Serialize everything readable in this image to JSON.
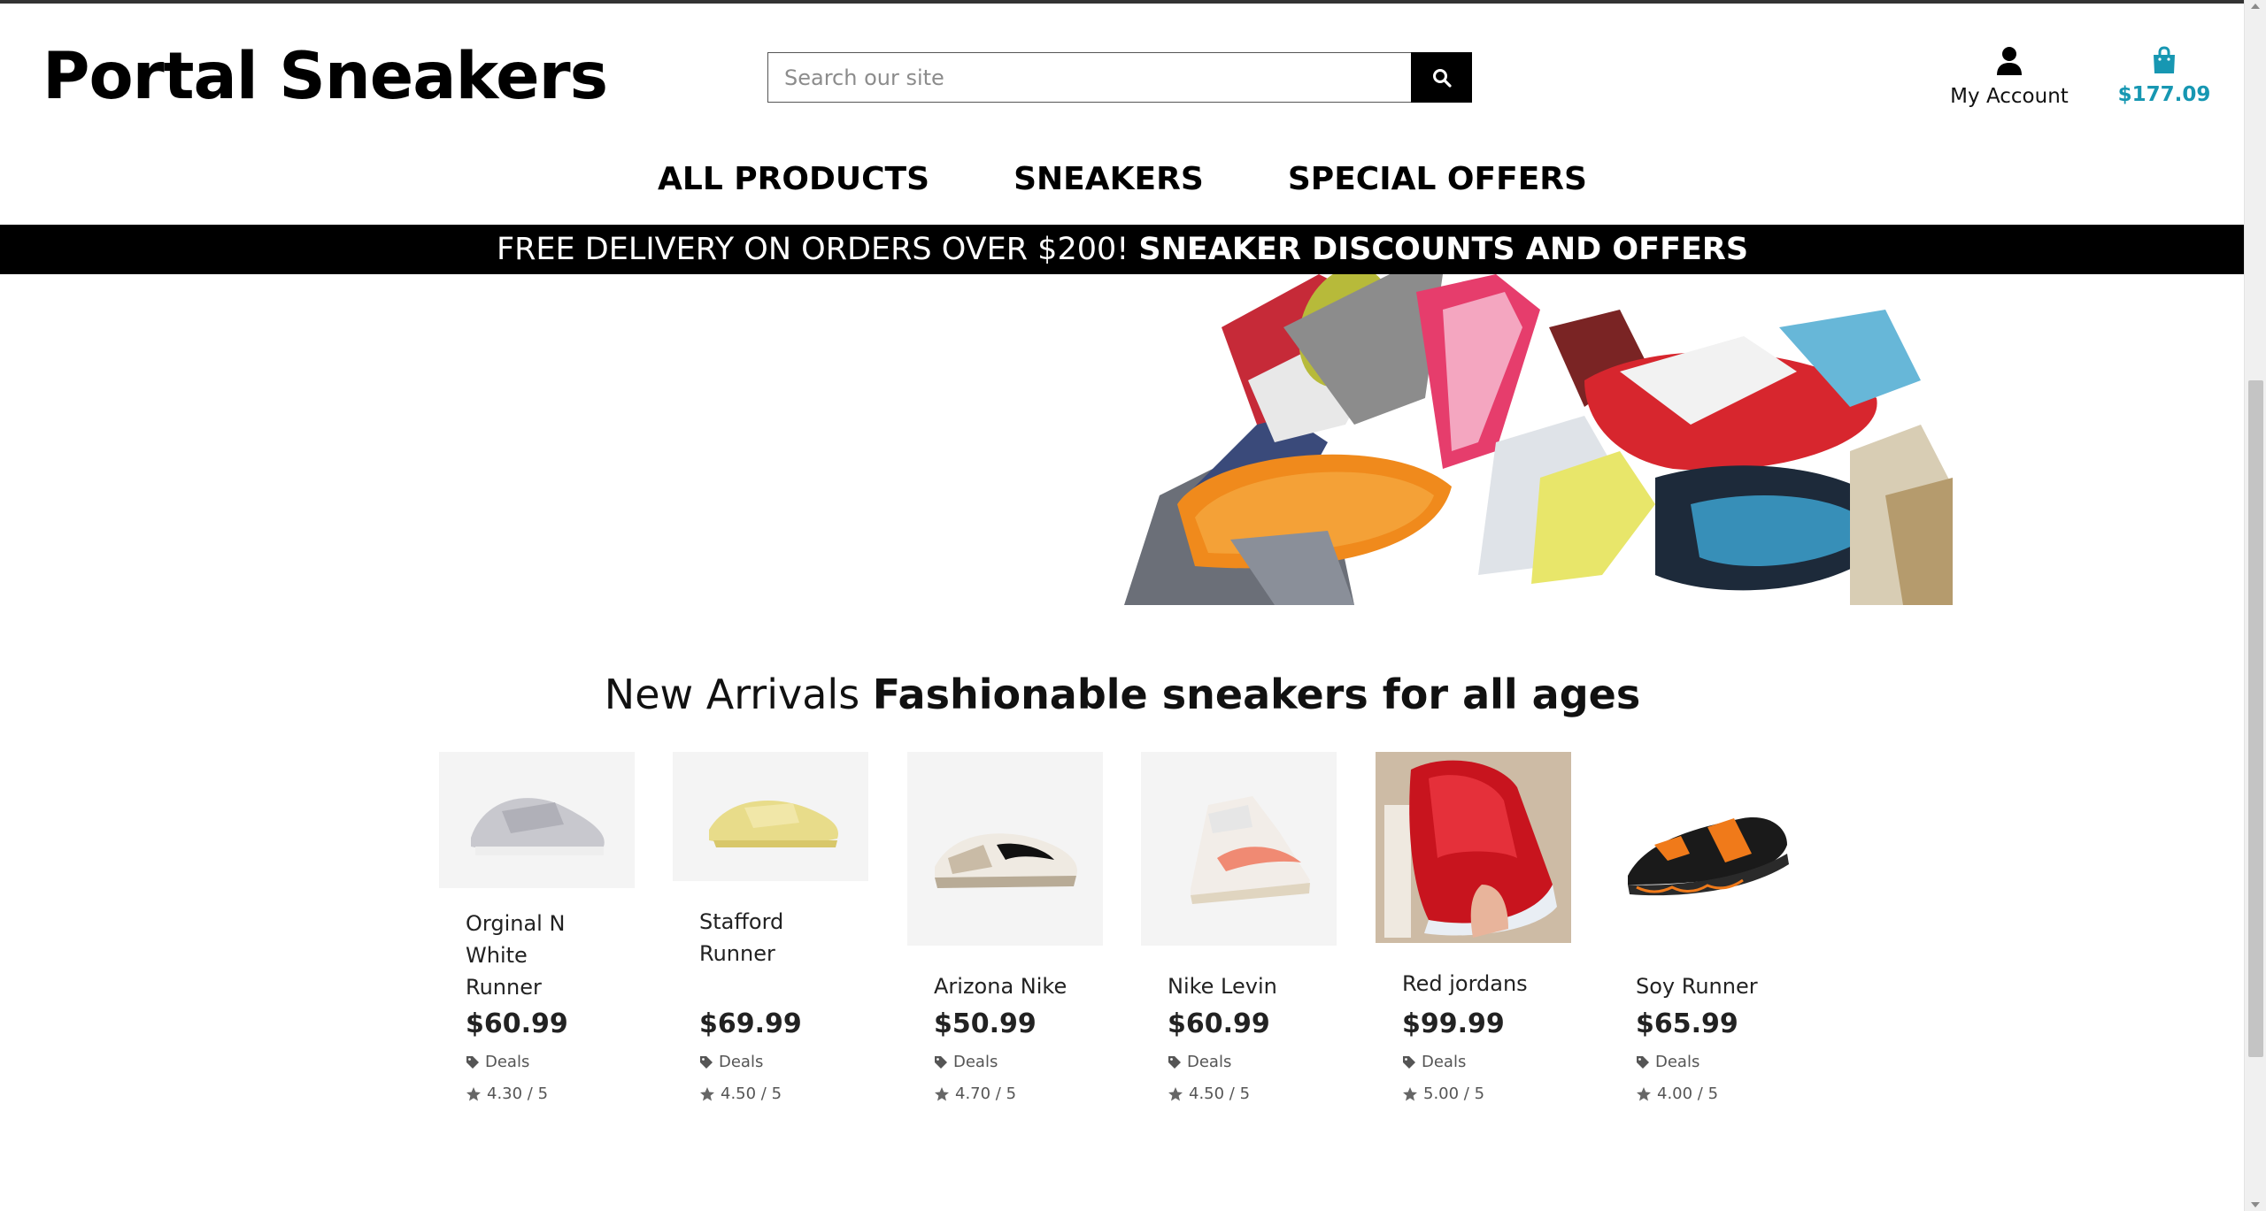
{
  "brand": {
    "name": "Portal Sneakers"
  },
  "search": {
    "placeholder": "Search our site"
  },
  "header": {
    "account_label": "My Account",
    "cart_total": "$177.09"
  },
  "nav": {
    "items": [
      "ALL PRODUCTS",
      "SNEAKERS",
      "SPECIAL OFFERS"
    ]
  },
  "promo": {
    "text": "FREE DELIVERY ON ORDERS OVER $200!",
    "bold_text": "SNEAKER DISCOUNTS AND OFFERS"
  },
  "section": {
    "title": "New Arrivals",
    "subtitle": "Fashionable sneakers for all ages"
  },
  "products": [
    {
      "name": "Orginal N White Runner",
      "price": "$60.99",
      "tag": "Deals",
      "rating": "4.30 / 5"
    },
    {
      "name": "Stafford Runner",
      "price": "$69.99",
      "tag": "Deals",
      "rating": "4.50 / 5"
    },
    {
      "name": "Arizona Nike",
      "price": "$50.99",
      "tag": "Deals",
      "rating": "4.70 / 5"
    },
    {
      "name": "Nike Levin",
      "price": "$60.99",
      "tag": "Deals",
      "rating": "4.50 / 5"
    },
    {
      "name": "Red jordans",
      "price": "$99.99",
      "tag": "Deals",
      "rating": "5.00 / 5"
    },
    {
      "name": "Soy Runner",
      "price": "$65.99",
      "tag": "Deals",
      "rating": "4.00 / 5"
    }
  ],
  "colors": {
    "accent": "#1797b2",
    "promo_bg": "#000000",
    "text": "#111111"
  },
  "icons": {
    "search": "search-icon",
    "account": "user-icon",
    "cart": "shopping-bag-icon",
    "deal": "tag-icon",
    "rating": "star-icon"
  }
}
